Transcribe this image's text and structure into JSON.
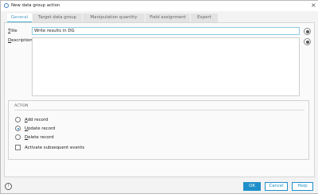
{
  "window": {
    "title": "New data group action"
  },
  "tabs": [
    {
      "label": "General",
      "active": true
    },
    {
      "label": "Target data group",
      "active": false
    },
    {
      "label": "Manipulation quantity",
      "active": false
    },
    {
      "label": "Field assignment",
      "active": false
    },
    {
      "label": "Expert",
      "active": false
    }
  ],
  "form": {
    "title_label": "Title",
    "title_value": "Write results in DG",
    "description_label": "Description",
    "description_value": ""
  },
  "action_group": {
    "title": "ACTION",
    "options": [
      {
        "label": "Add record",
        "checked": false
      },
      {
        "label": "Update record",
        "checked": true
      },
      {
        "label": "Delete record",
        "checked": false
      }
    ],
    "activate_events": {
      "label": "Activate subsequent events",
      "checked": false
    }
  },
  "footer": {
    "ok_label": "OK",
    "cancel_label": "Cancel",
    "help_label": "Help"
  },
  "colors": {
    "accent": "#1f8fc9",
    "active_tab_text": "#4c9fc4"
  }
}
